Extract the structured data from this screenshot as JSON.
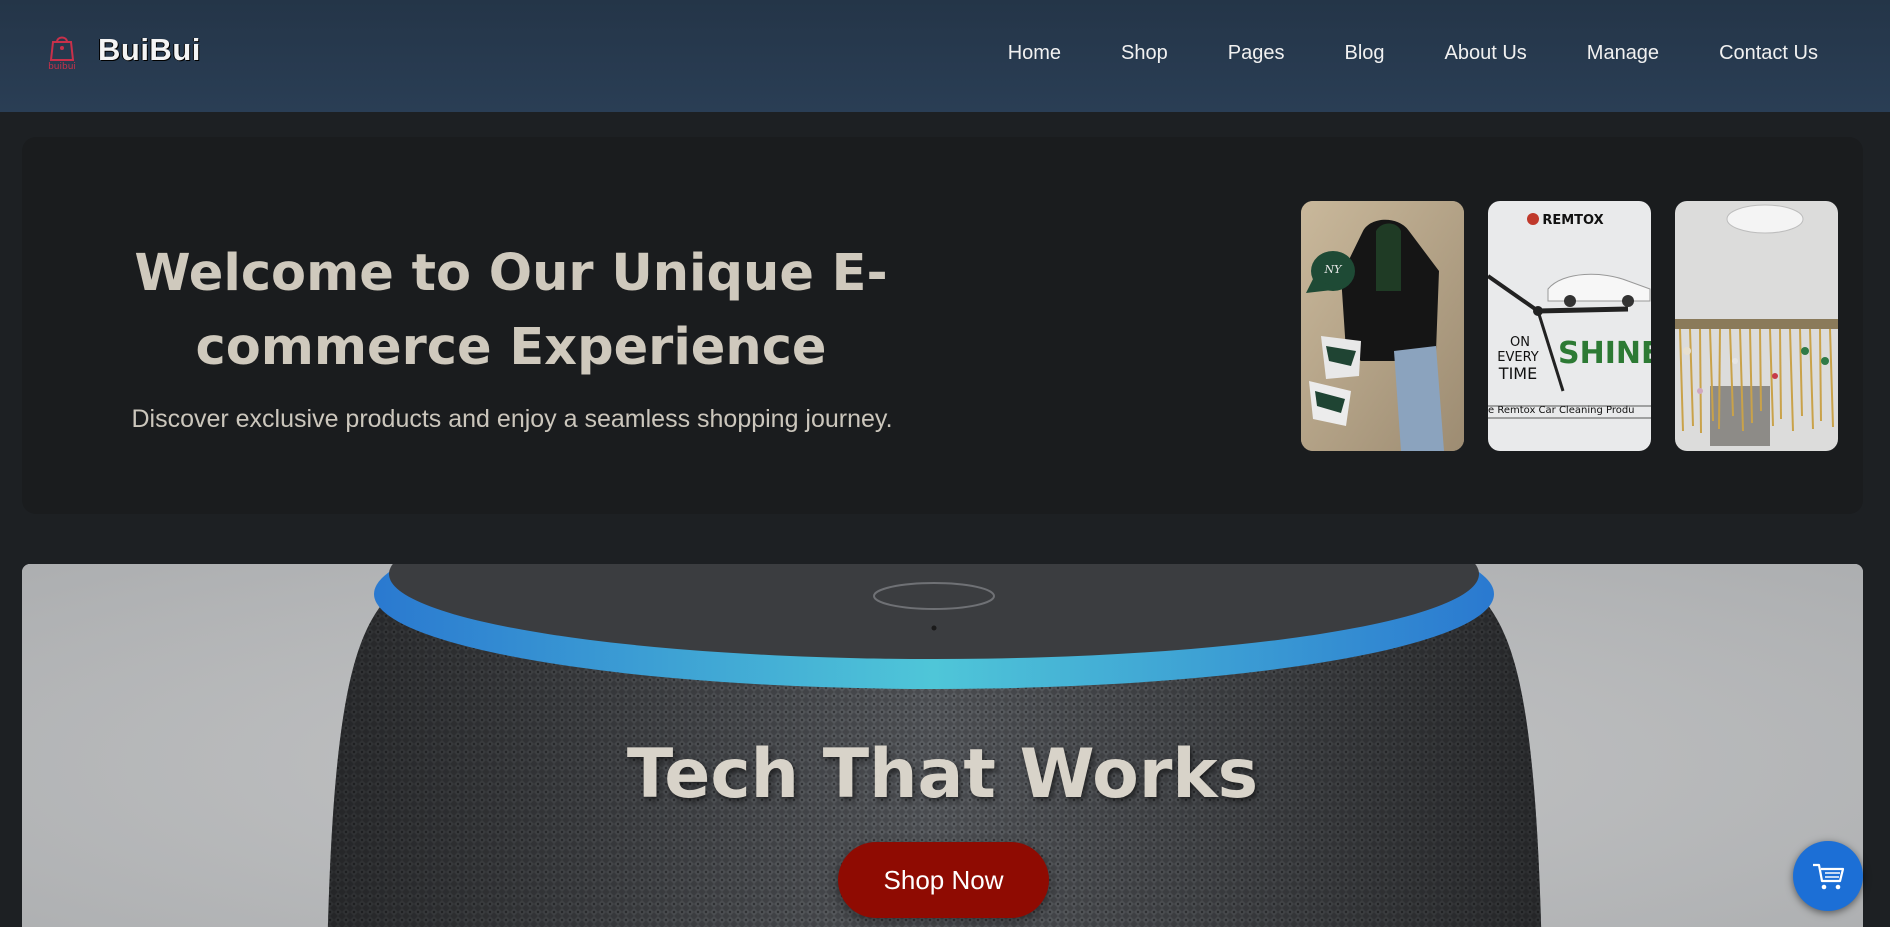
{
  "brand": {
    "name": "BuiBui",
    "logo_text": "buibui",
    "logo_icon": "shopping-bag-icon"
  },
  "nav": {
    "items": [
      {
        "label": "Home"
      },
      {
        "label": "Shop"
      },
      {
        "label": "Pages"
      },
      {
        "label": "Blog"
      },
      {
        "label": "About Us"
      },
      {
        "label": "Manage"
      },
      {
        "label": "Contact Us"
      }
    ]
  },
  "hero": {
    "title_line1": "Welcome to Our Unique E-",
    "title_line2": "commerce Experience",
    "subtitle": "Discover exclusive products and enjoy a seamless shopping journey.",
    "thumbnails": [
      {
        "name": "fashion-outfit-image",
        "text": "NY"
      },
      {
        "name": "remtox-ad-image",
        "brand": "REMTOX",
        "line1": "ON",
        "line2": "EVERY",
        "line3": "TIME",
        "shine": "SHINE",
        "caption": "e Remtox Car Cleaning Produ"
      },
      {
        "name": "jewelry-display-image"
      }
    ]
  },
  "banner": {
    "title": "Tech That Works",
    "button_label": "Shop Now"
  },
  "cart_fab": {
    "icon": "cart-icon"
  },
  "colors": {
    "navbar": "#243548",
    "hero_bg": "#1a1c1e",
    "button": "#8f0b02",
    "fab": "#1c6fd6",
    "speaker_ring": "#2a8ae0"
  }
}
